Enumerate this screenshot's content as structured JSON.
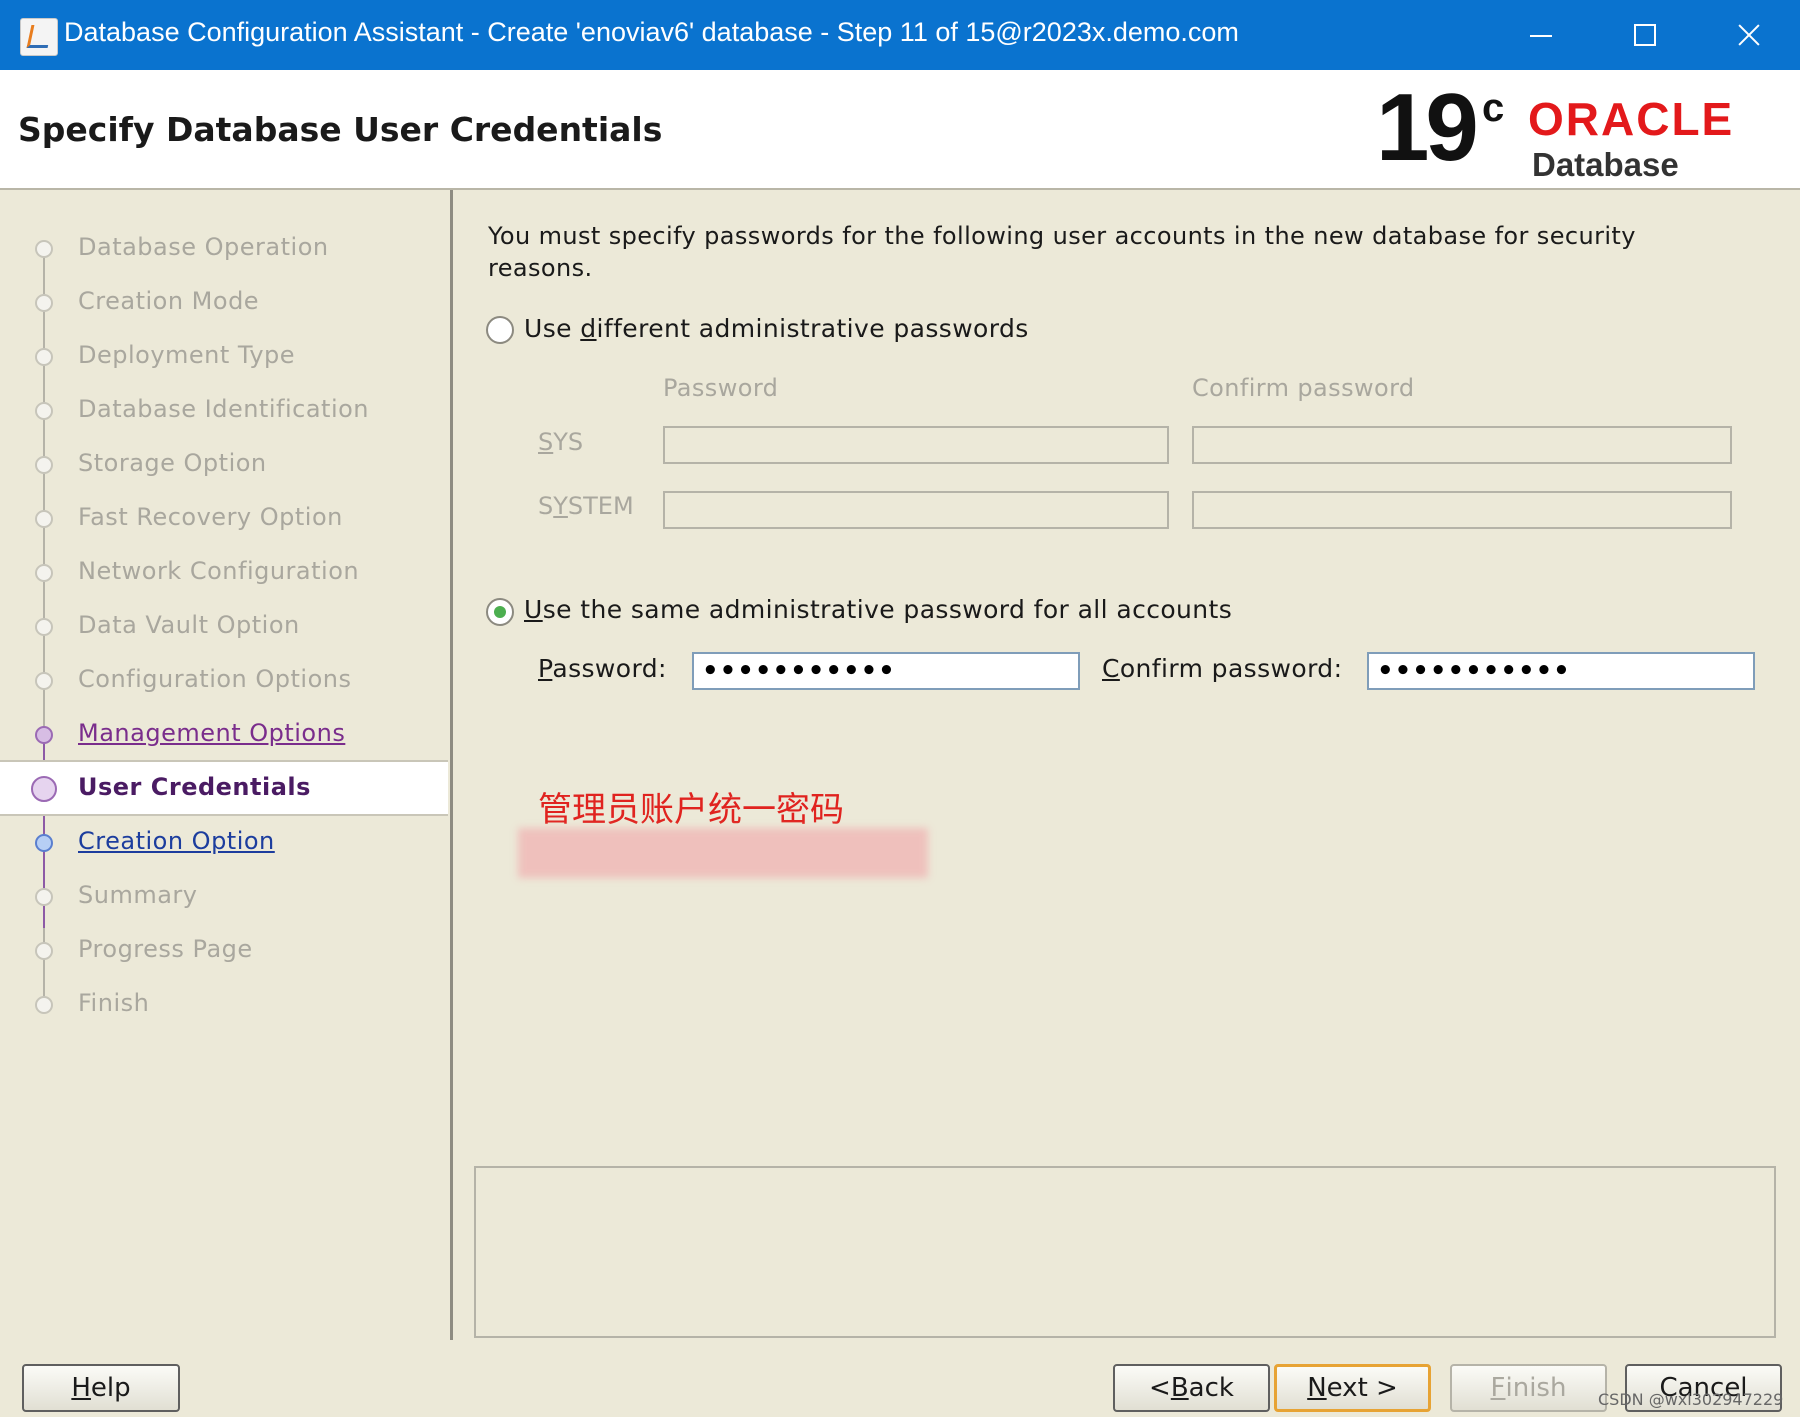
{
  "window": {
    "title": "Database Configuration Assistant - Create 'enoviav6' database - Step 11 of 15@r2023x.demo.com"
  },
  "header": {
    "page_title": "Specify Database User Credentials",
    "logo_version": "19",
    "logo_sup": "c",
    "logo_brand": "ORACLE",
    "logo_product": "Database",
    "brand_color": "#e3191b"
  },
  "sidebar": {
    "steps": [
      {
        "label": "Database Operation",
        "state": "done"
      },
      {
        "label": "Creation Mode",
        "state": "done"
      },
      {
        "label": "Deployment Type",
        "state": "done"
      },
      {
        "label": "Database Identification",
        "state": "done"
      },
      {
        "label": "Storage Option",
        "state": "done"
      },
      {
        "label": "Fast Recovery Option",
        "state": "done"
      },
      {
        "label": "Network Configuration",
        "state": "done"
      },
      {
        "label": "Data Vault Option",
        "state": "done"
      },
      {
        "label": "Configuration Options",
        "state": "done"
      },
      {
        "label": "Management Options",
        "state": "link"
      },
      {
        "label": "User Credentials",
        "state": "current"
      },
      {
        "label": "Creation Option",
        "state": "next"
      },
      {
        "label": "Summary",
        "state": "pending"
      },
      {
        "label": "Progress Page",
        "state": "pending"
      },
      {
        "label": "Finish",
        "state": "pending"
      }
    ]
  },
  "content": {
    "intro": "You must specify passwords for the following user accounts in the new database for security reasons.",
    "option_different": {
      "pre": "Use ",
      "mnemonic": "d",
      "post": "ifferent administrative passwords",
      "selected": false
    },
    "grid": {
      "col_password": "Password",
      "col_confirm": "Confirm password",
      "rows": [
        {
          "mnemonic": "S",
          "rest": "YS"
        },
        {
          "pre": "S",
          "mnemonic": "Y",
          "rest": "STEM"
        }
      ]
    },
    "option_same": {
      "mnemonic": "U",
      "post": "se the same administrative password for all accounts",
      "selected": true
    },
    "password_label": {
      "mnemonic": "P",
      "rest": "assword:"
    },
    "password_value": "•••••••••••",
    "confirm_label": {
      "mnemonic": "C",
      "rest": "onfirm password:"
    },
    "confirm_value": "•••••••••••",
    "annotation": "管理员账户统一密码"
  },
  "buttons": {
    "help": {
      "mnemonic": "H",
      "rest": "elp"
    },
    "back": {
      "pre": "< ",
      "mnemonic": "B",
      "rest": "ack"
    },
    "next": {
      "mnemonic": "N",
      "rest": "ext >"
    },
    "finish": {
      "mnemonic": "F",
      "rest": "inish"
    },
    "cancel": "Cancel"
  },
  "watermark": "CSDN @wxl302947229"
}
